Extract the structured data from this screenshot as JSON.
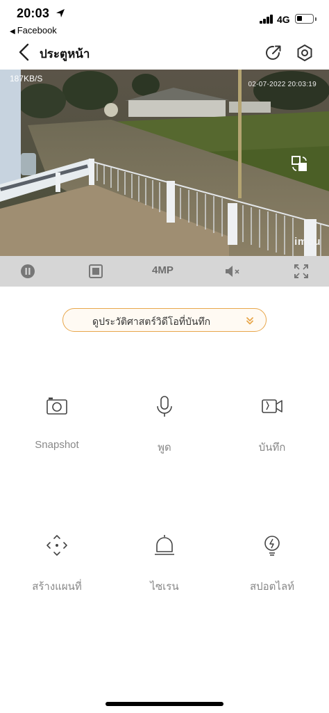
{
  "status_bar": {
    "time": "20:03",
    "back_app": "Facebook",
    "network": "4G"
  },
  "nav": {
    "title": "ประตูหน้า"
  },
  "video": {
    "bitrate": "187KB/S",
    "timestamp": "02-07-2022 20:03:19",
    "brand": "imou"
  },
  "controls": {
    "quality": "4MP"
  },
  "history": {
    "label": "ดูประวัติศาสตร์วิดีโอที่บันทึก"
  },
  "functions": [
    {
      "label": "Snapshot",
      "icon": "camera-icon"
    },
    {
      "label": "พูด",
      "icon": "microphone-icon"
    },
    {
      "label": "บันทึก",
      "icon": "video-record-icon"
    },
    {
      "label": "สร้างแผนที่",
      "icon": "ptz-move-icon"
    },
    {
      "label": "ไซเรน",
      "icon": "siren-icon"
    },
    {
      "label": "สปอตไลท์",
      "icon": "spotlight-icon"
    }
  ],
  "colors": {
    "accent": "#e8a64a",
    "control_bar": "#d6d6d6",
    "icon_gray": "#555555",
    "label_gray": "#888888"
  }
}
